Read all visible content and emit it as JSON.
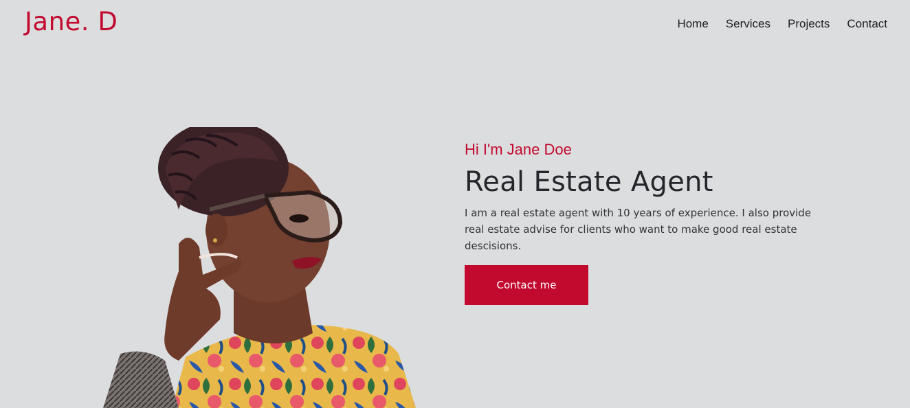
{
  "brand": {
    "logo_text": "Jane. D",
    "accent_color": "#c20a2f"
  },
  "nav": {
    "items": [
      {
        "label": "Home"
      },
      {
        "label": "Services"
      },
      {
        "label": "Projects"
      },
      {
        "label": "Contact"
      }
    ]
  },
  "hero": {
    "greeting": "Hi I'm Jane Doe",
    "title": "Real Estate Agent",
    "description": "I am a real estate agent with 10 years of experience. I also provide real estate advise for clients who want to make good real estate descisions.",
    "cta_label": "Contact me",
    "portrait": {
      "icon": "portrait-photo",
      "alt": "Portrait of Jane Doe"
    }
  },
  "colors": {
    "background": "#dcdddf",
    "accent": "#c20a2f",
    "text_dark": "#23262a"
  }
}
